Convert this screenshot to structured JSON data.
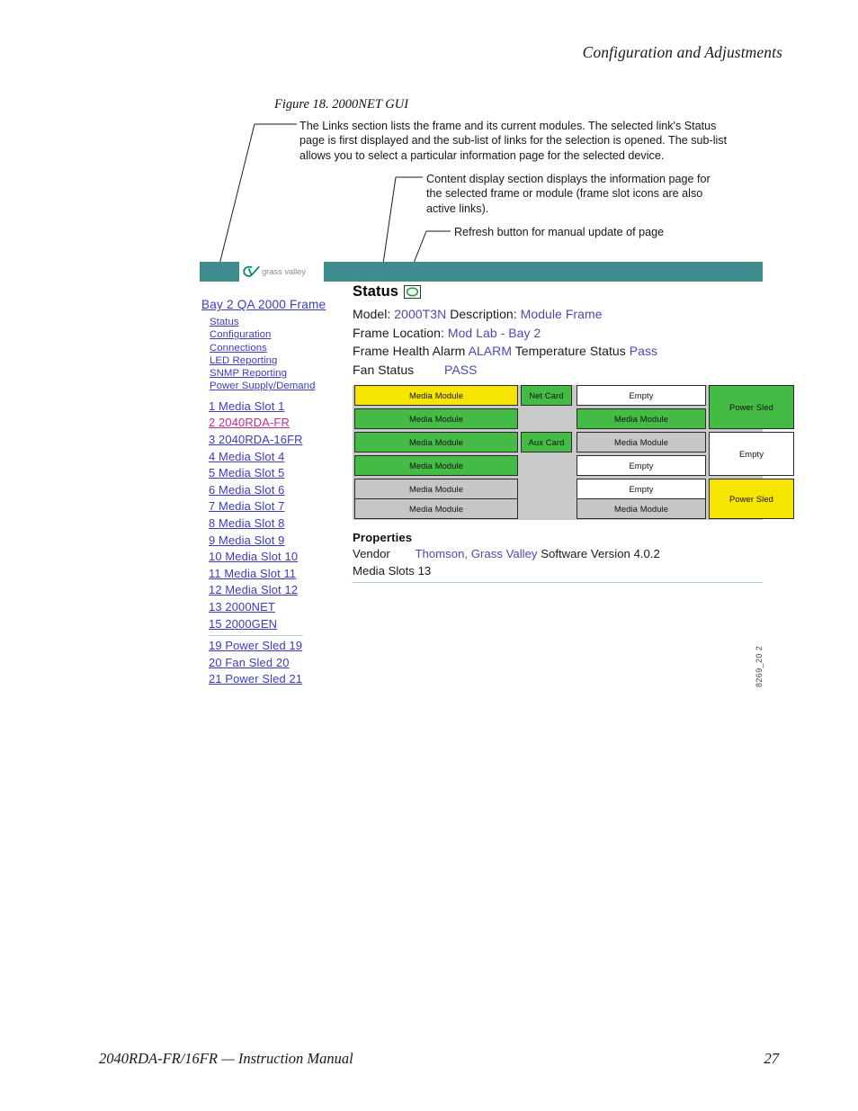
{
  "page": {
    "running_head": "Configuration and Adjustments",
    "footer_left": "2040RDA-FR/16FR — Instruction Manual",
    "footer_page": "27",
    "figure_id": "8269_20 2"
  },
  "figure": {
    "caption": "Figure 18.  2000NET GUI",
    "callouts": {
      "links": "The Links section lists the frame and its current modules. The selected link's Status page is first displayed and the sub-list of links for the selection is opened. The sub-list allows you to select a particular information page for the selected device.",
      "content": "Content display section displays the information page for the selected frame or module (frame slot icons are also active links).",
      "refresh": "Refresh button for manual update of page"
    }
  },
  "gui": {
    "banner": {
      "logo_text": "grass valley",
      "logo_mark": "gv-logo-icon",
      "color": "#3e8c8c"
    },
    "links": {
      "frame": "Bay 2 QA 2000 Frame",
      "sub_items": [
        "Status",
        "Configuration",
        "Connections",
        "LED Reporting",
        "SNMP Reporting",
        "Power Supply/Demand"
      ],
      "slots": [
        {
          "label": "1  Media Slot 1",
          "visited": false
        },
        {
          "label": "2 2040RDA-FR",
          "visited": true
        },
        {
          "label": "3 2040RDA-16FR",
          "visited": false
        },
        {
          "label": "4 Media Slot 4",
          "visited": false
        },
        {
          "label": "5 Media Slot 5",
          "visited": false
        },
        {
          "label": "6 Media Slot 6",
          "visited": false
        },
        {
          "label": "7 Media Slot 7",
          "visited": false
        },
        {
          "label": "8  Media Slot 8",
          "visited": false
        },
        {
          "label": "9 Media Slot 9",
          "visited": false
        },
        {
          "label": "10 Media Slot 10",
          "visited": false
        },
        {
          "label": "11  Media Slot 11",
          "visited": false
        },
        {
          "label": "12 Media Slot 12",
          "visited": false
        },
        {
          "label": "13 2000NET",
          "visited": false
        },
        {
          "label": "15 2000GEN",
          "visited": false
        }
      ],
      "sleds": [
        {
          "label": "19 Power Sled 19"
        },
        {
          "label": "20 Fan Sled 20"
        },
        {
          "label": "21  Power Sled 21"
        }
      ]
    },
    "status": {
      "heading": "Status",
      "refresh_icon": "refresh-icon",
      "model_label": "Model:",
      "model_value": "2000T3N",
      "description_label": "Description:",
      "description_value": "Module Frame",
      "location_label": "Frame Location:",
      "location_value": "Mod Lab - Bay 2",
      "health_label": "Frame Health Alarm",
      "health_value": "ALARM",
      "temperature_label": "Temperature Status",
      "temperature_value": "Pass",
      "fan_label": "Fan Status",
      "fan_value": "PASS"
    },
    "slot_grid": {
      "left_column": [
        {
          "label": "Media Module",
          "state": "yellow"
        },
        {
          "label": "Media Module",
          "state": "green"
        },
        {
          "label": "Media Module",
          "state": "green"
        },
        {
          "label": "Media Module",
          "state": "green"
        },
        {
          "label": "Media Module",
          "state": "gray"
        },
        {
          "label": "Media Module",
          "state": "gray"
        }
      ],
      "middle_column": [
        {
          "label": "Net Card",
          "state": "green"
        },
        {
          "label": "Aux Card",
          "state": "green"
        }
      ],
      "right_column": [
        {
          "label": "Empty",
          "state": "white"
        },
        {
          "label": "Media Module",
          "state": "green"
        },
        {
          "label": "Media Module",
          "state": "gray"
        },
        {
          "label": "Empty",
          "state": "white"
        },
        {
          "label": "Empty",
          "state": "white"
        },
        {
          "label": "Media Module",
          "state": "gray"
        }
      ],
      "sled_column": [
        {
          "label": "Power Sled",
          "state": "green"
        },
        {
          "label": "Empty",
          "state": "white"
        },
        {
          "label": "Power Sled",
          "state": "yellow"
        }
      ]
    },
    "properties": {
      "title": "Properties",
      "vendor_label": "Vendor",
      "vendor_value": "Thomson, Grass Valley",
      "software_label": "Software Version",
      "software_value": "4.0.2",
      "media_slots_label": "Media Slots",
      "media_slots_value": "13"
    }
  }
}
